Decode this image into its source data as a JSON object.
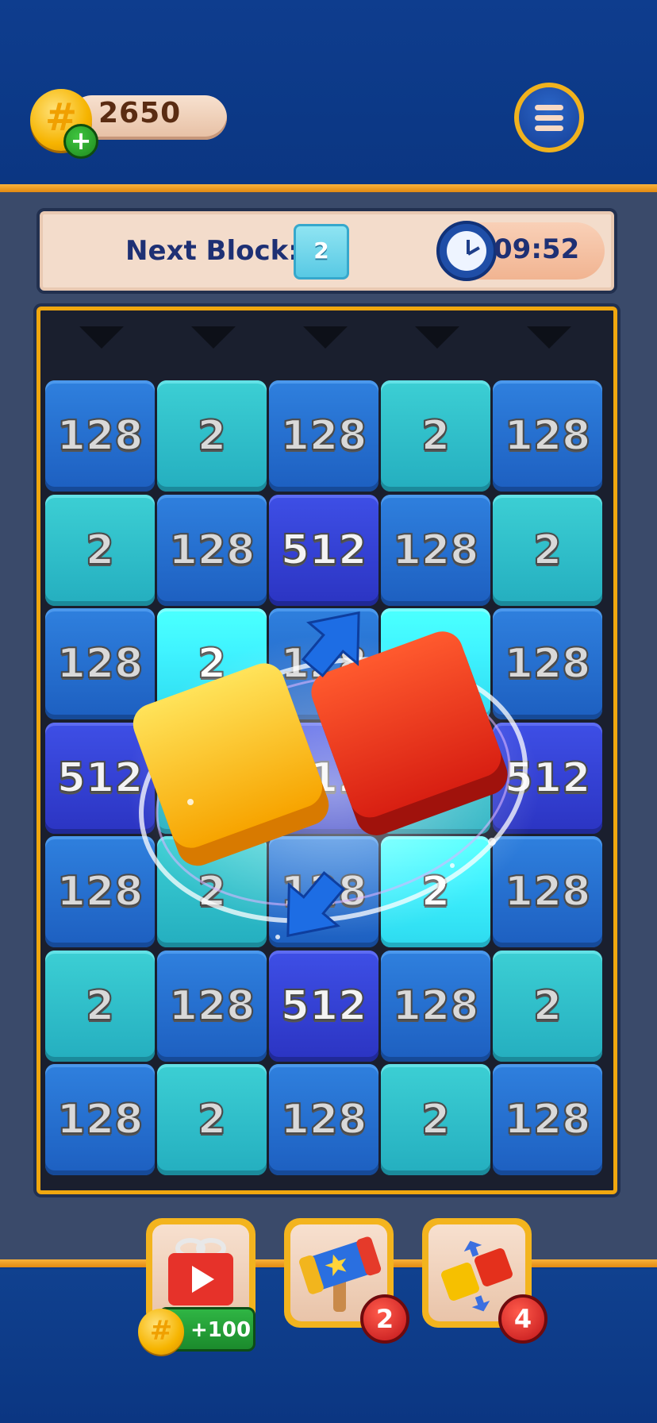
{
  "header": {
    "coins": "2650",
    "coin_symbol": "#",
    "add_symbol": "+",
    "menu_icon": "hamburger-menu-icon"
  },
  "status_bar": {
    "next_block_label": "Next Block:",
    "next_block_value": "2",
    "timer": "09:52",
    "timer_icon": "clock-icon"
  },
  "board": {
    "columns": 5,
    "rows": [
      [
        "128",
        "2",
        "128",
        "2",
        "128"
      ],
      [
        "2",
        "128",
        "512",
        "128",
        "2"
      ],
      [
        "128",
        "2",
        "128",
        "2",
        "128"
      ],
      [
        "512",
        "2",
        "512",
        "2",
        "512"
      ],
      [
        "128",
        "2",
        "128",
        "2",
        "128"
      ],
      [
        "2",
        "128",
        "512",
        "128",
        "2"
      ],
      [
        "128",
        "2",
        "128",
        "2",
        "128"
      ]
    ]
  },
  "tools": {
    "reward_video": {
      "icon": "gift-video-icon",
      "reward": "+100",
      "coin_symbol": "#"
    },
    "hammer": {
      "icon": "hammer-icon",
      "count": "2"
    },
    "swap": {
      "icon": "swap-blocks-icon",
      "count": "4"
    }
  },
  "colors": {
    "tile_128": "#2f80de",
    "tile_2": "#3ccfd4",
    "tile_512": "#3e4fe6",
    "border_gold": "#f0a70f",
    "background_blue": "#0d3a8a"
  }
}
